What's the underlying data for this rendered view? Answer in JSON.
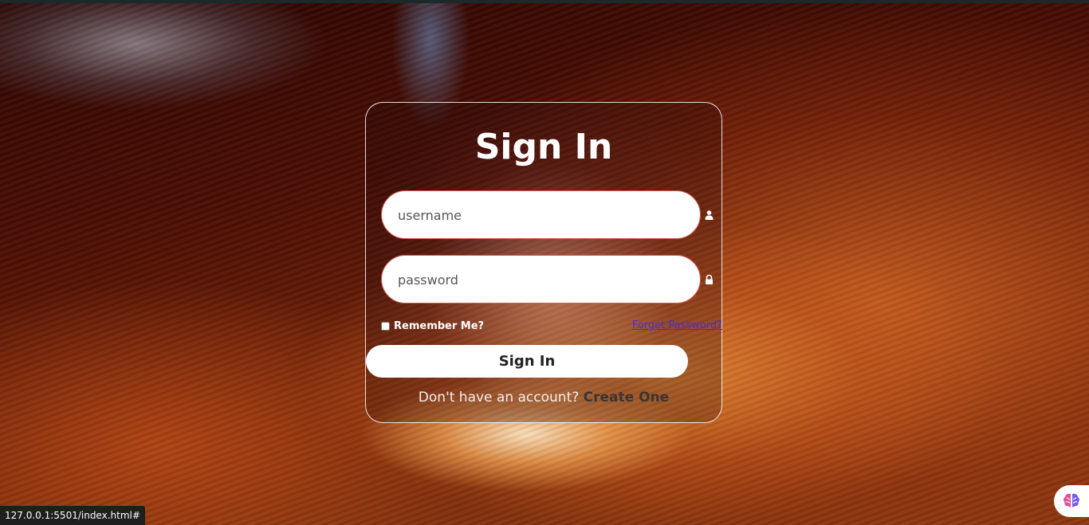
{
  "login": {
    "title": "Sign In",
    "username_placeholder": "username",
    "password_placeholder": "password",
    "remember_label": "Remember Me?",
    "forget_link": "Forget Password?",
    "submit_label": "Sign In",
    "signup_text": "Don't have an account?",
    "signup_link": "Create One"
  },
  "icons": {
    "username": "user-icon",
    "password": "lock-icon",
    "extension": "brain-icon"
  },
  "status_bar": {
    "url": "127.0.0.1:5501/index.html#"
  },
  "colors": {
    "link": "#4b2ad8",
    "input_border": "#d85a4a",
    "create_link": "#3a3434"
  }
}
